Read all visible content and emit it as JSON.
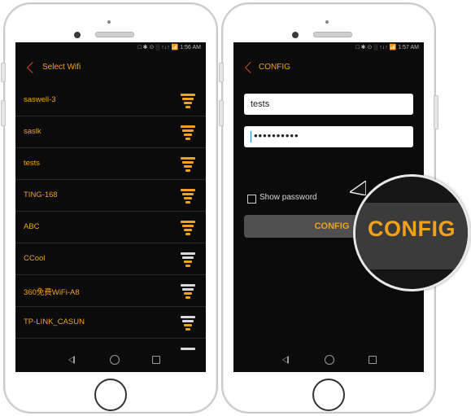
{
  "colors": {
    "accent": "#f0a21e",
    "back": "#c94b1c",
    "screen": "#0b0b0b",
    "button": "#505050"
  },
  "left_phone": {
    "status_bar": "□ ✱ ⊙ ░ ↑↓↑ 📶 1:56 AM",
    "header": {
      "back_icon": "chevron-left-icon",
      "title": "Select Wifi"
    },
    "wifi_list": [
      {
        "ssid": "saswell-3",
        "signal": "full"
      },
      {
        "ssid": "saslk",
        "signal": "full"
      },
      {
        "ssid": "tests",
        "signal": "full"
      },
      {
        "ssid": "TING-168",
        "signal": "full"
      },
      {
        "ssid": "ABC",
        "signal": "full"
      },
      {
        "ssid": "CCool",
        "signal": "weak"
      },
      {
        "ssid": "360免费WiFi-A8",
        "signal": "weak"
      },
      {
        "ssid": "TP-LINK_CASUN",
        "signal": "weak"
      },
      {
        "ssid": "",
        "signal": "weak"
      }
    ],
    "navbar": {
      "back": "back-icon",
      "home": "home-icon",
      "recent": "recents-icon"
    }
  },
  "right_phone": {
    "status_bar": "□ ✱ ⊙ ░ ↑↓↑ 📶 1:57 AM",
    "header": {
      "back_icon": "chevron-left-icon",
      "title": "CONFIG"
    },
    "ssid_field": {
      "value": "tests"
    },
    "password_field": {
      "value": "••••••••••"
    },
    "show_password": {
      "label": "Show password",
      "checked": false
    },
    "config_button": {
      "label": "CONFIG"
    },
    "magnified_label": "CONFIG",
    "navbar": {
      "back": "back-icon",
      "home": "home-icon",
      "recent": "recents-icon"
    }
  }
}
